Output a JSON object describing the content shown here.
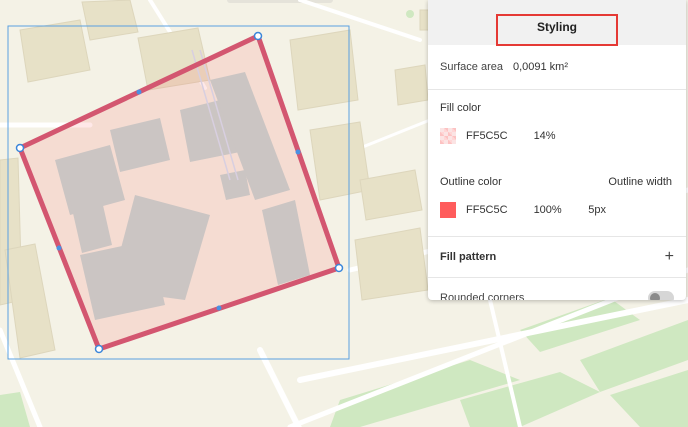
{
  "panel": {
    "tab_styling": "Styling",
    "surface_area_label": "Surface area",
    "surface_area_value": "0,0091 km²",
    "fill_color_label": "Fill color",
    "fill_color_hex": "FF5C5C",
    "fill_opacity": "14%",
    "outline_color_label": "Outline color",
    "outline_width_label": "Outline width",
    "outline_color_hex": "FF5C5C",
    "outline_opacity": "100%",
    "outline_width_value": "5px",
    "fill_pattern_label": "Fill pattern",
    "fill_pattern_action": "+",
    "rounded_corners_label": "Rounded corners",
    "rounded_corners_enabled": false
  },
  "colors": {
    "shape_color": "#FF5C5C",
    "selection_box": "#5aa0e0",
    "highlight_border": "#e53935"
  },
  "icons": {
    "fill_swatch": "checkered-swatch-icon",
    "outline_swatch": "solid-swatch-icon",
    "add": "plus-icon",
    "toggle": "toggle-switch"
  }
}
